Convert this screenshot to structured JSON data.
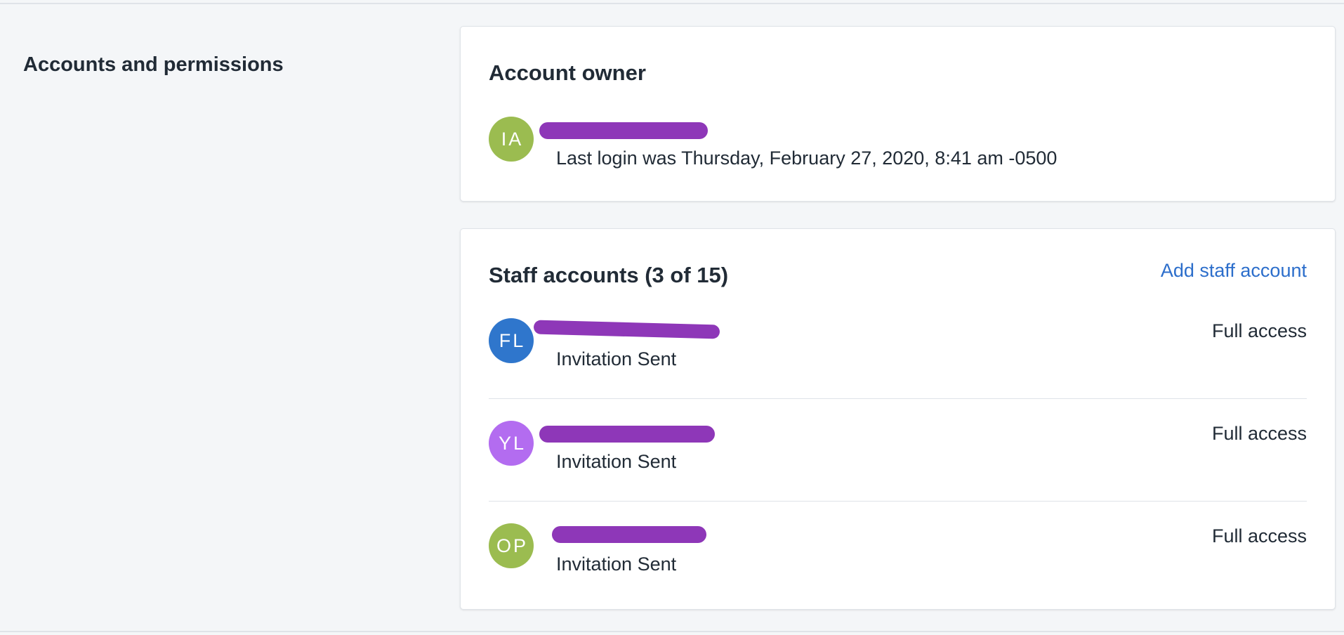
{
  "section": {
    "title": "Accounts and permissions"
  },
  "owner_card": {
    "title": "Account owner",
    "owner": {
      "initials": "IA",
      "avatar_color": "#9bbc50",
      "last_login": "Last login was Thursday, February 27, 2020, 8:41 am -0500"
    }
  },
  "staff_card": {
    "title": "Staff accounts (3 of 15)",
    "add_link": "Add staff account",
    "accounts": [
      {
        "initials": "FL",
        "avatar_color": "#2f76cc",
        "status": "Invitation Sent",
        "access": "Full access"
      },
      {
        "initials": "YL",
        "avatar_color": "#b36cf0",
        "status": "Invitation Sent",
        "access": "Full access"
      },
      {
        "initials": "OP",
        "avatar_color": "#9bbc50",
        "status": "Invitation Sent",
        "access": "Full access"
      }
    ]
  },
  "colors": {
    "redaction": "#8e37b8",
    "link": "#2c6ecb",
    "background": "#f4f6f8"
  }
}
